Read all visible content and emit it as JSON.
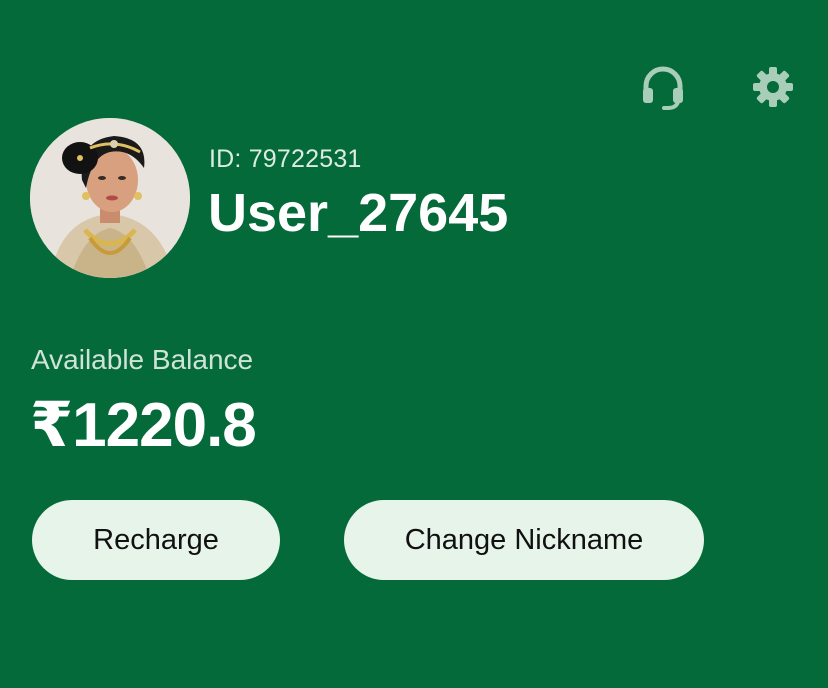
{
  "header": {
    "support_icon": "headset-icon",
    "settings_icon": "gear-icon",
    "icon_color": "#a8cdb8"
  },
  "profile": {
    "id_text": "ID: 79722531",
    "username": "User_27645",
    "avatar": "user-avatar-photo"
  },
  "wallet": {
    "balance_label": "Available Balance",
    "balance_value": "₹1220.8"
  },
  "actions": {
    "recharge_label": "Recharge",
    "change_nickname_label": "Change Nickname"
  },
  "colors": {
    "background": "#056a3a",
    "button_bg": "#e6f4ea",
    "button_text": "#111111"
  }
}
